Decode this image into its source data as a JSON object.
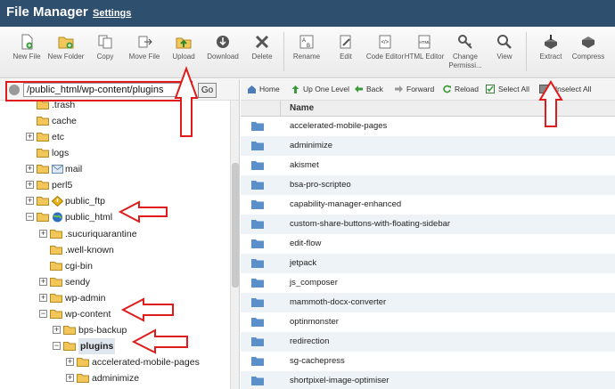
{
  "header": {
    "title": "File Manager",
    "settings_link": "Settings"
  },
  "toolbar": {
    "items": [
      {
        "label": "New File",
        "icon": "new-file-icon"
      },
      {
        "label": "New Folder",
        "icon": "new-folder-icon"
      },
      {
        "label": "Copy",
        "icon": "copy-icon"
      },
      {
        "label": "Move File",
        "icon": "move-icon"
      },
      {
        "label": "Upload",
        "icon": "upload-icon"
      },
      {
        "label": "Download",
        "icon": "download-icon"
      },
      {
        "label": "Delete",
        "icon": "delete-icon"
      },
      {
        "label": "Rename",
        "icon": "rename-icon"
      },
      {
        "label": "Edit",
        "icon": "edit-icon"
      },
      {
        "label": "Code Editor",
        "icon": "code-editor-icon"
      },
      {
        "label": "HTML Editor",
        "icon": "html-editor-icon"
      },
      {
        "label": "Change Permissi...",
        "icon": "permissions-icon"
      },
      {
        "label": "View",
        "icon": "view-icon"
      },
      {
        "label": "Extract",
        "icon": "extract-icon"
      },
      {
        "label": "Compress",
        "icon": "compress-icon"
      }
    ]
  },
  "path": {
    "value": "/public_html/wp-content/plugins",
    "go_label": "Go"
  },
  "tree": [
    {
      "label": ".trash",
      "expander": ""
    },
    {
      "label": "cache",
      "expander": ""
    },
    {
      "label": "etc",
      "expander": "+"
    },
    {
      "label": "logs",
      "expander": ""
    },
    {
      "label": "mail",
      "expander": "+"
    },
    {
      "label": "perl5",
      "expander": "+"
    },
    {
      "label": "public_ftp",
      "expander": "+"
    },
    {
      "label": "public_html",
      "expander": "−"
    },
    {
      "label": ".sucuriquarantine",
      "expander": "+"
    },
    {
      "label": ".well-known",
      "expander": ""
    },
    {
      "label": "cgi-bin",
      "expander": ""
    },
    {
      "label": "sendy",
      "expander": "+"
    },
    {
      "label": "wp-admin",
      "expander": "+"
    },
    {
      "label": "wp-content",
      "expander": "−"
    },
    {
      "label": "bps-backup",
      "expander": "+"
    },
    {
      "label": "plugins",
      "expander": "−"
    },
    {
      "label": "accelerated-mobile-pages",
      "expander": "+"
    },
    {
      "label": "adminimize",
      "expander": "+"
    }
  ],
  "filetoolbar": {
    "home": "Home",
    "up": "Up One Level",
    "back": "Back",
    "forward": "Forward",
    "reload": "Reload",
    "select_all": "Select All",
    "unselect_all": "Unselect All"
  },
  "files": {
    "column_name": "Name",
    "rows": [
      "accelerated-mobile-pages",
      "adminimize",
      "akismet",
      "bsa-pro-scripteo",
      "capability-manager-enhanced",
      "custom-share-buttons-with-floating-sidebar",
      "edit-flow",
      "jetpack",
      "js_composer",
      "mammoth-docx-converter",
      "optinmonster",
      "redirection",
      "sg-cachepress",
      "shortpixel-image-optimiser"
    ]
  },
  "colors": {
    "header_bg": "#2f4f6f",
    "annotation": "#e01b1b",
    "folder": "#f3c65a",
    "file_folder": "#5b8fc9"
  }
}
